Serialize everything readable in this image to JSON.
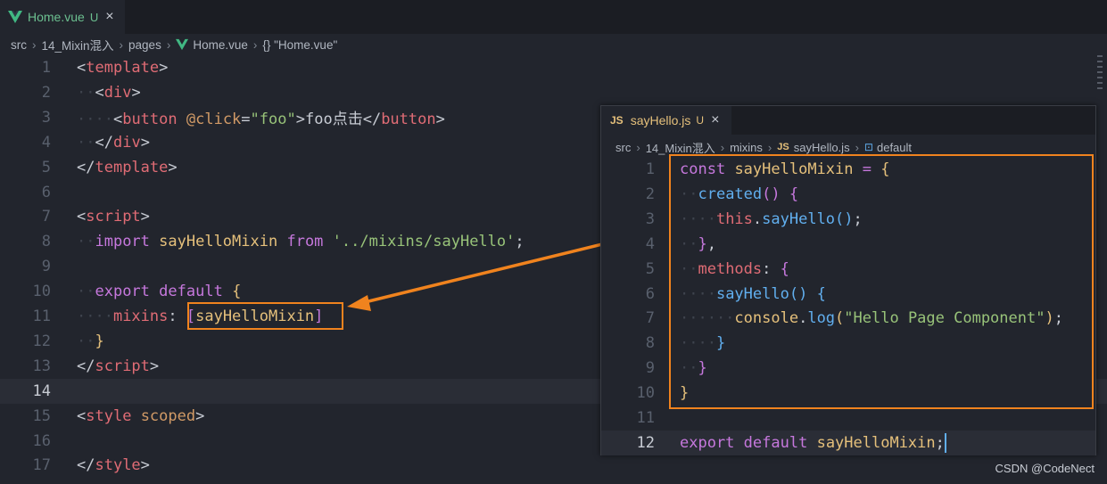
{
  "main_tab": {
    "name": "Home.vue",
    "status": "U",
    "close": "×"
  },
  "breadcrumb": [
    "src",
    "14_Mixin混入",
    "pages",
    "Home.vue",
    "{} \"Home.vue\""
  ],
  "main_lines": [
    {
      "n": "1",
      "code": [
        [
          "t-brk",
          "<"
        ],
        [
          "t-tag",
          "template"
        ],
        [
          "t-brk",
          ">"
        ]
      ]
    },
    {
      "n": "2",
      "code": [
        [
          "indent",
          "··"
        ],
        [
          "t-brk",
          "<"
        ],
        [
          "t-tag",
          "div"
        ],
        [
          "t-brk",
          ">"
        ]
      ]
    },
    {
      "n": "3",
      "code": [
        [
          "indent",
          "····"
        ],
        [
          "t-brk",
          "<"
        ],
        [
          "t-tag",
          "button"
        ],
        [
          "t-plain",
          " "
        ],
        [
          "t-attr",
          "@click"
        ],
        [
          "t-plain",
          "="
        ],
        [
          "t-str",
          "\"foo\""
        ],
        [
          "t-brk",
          ">"
        ],
        [
          "t-plain",
          "foo点击"
        ],
        [
          "t-brk",
          "</"
        ],
        [
          "t-tag",
          "button"
        ],
        [
          "t-brk",
          ">"
        ]
      ]
    },
    {
      "n": "4",
      "code": [
        [
          "indent",
          "··"
        ],
        [
          "t-brk",
          "</"
        ],
        [
          "t-tag",
          "div"
        ],
        [
          "t-brk",
          ">"
        ]
      ]
    },
    {
      "n": "5",
      "code": [
        [
          "t-brk",
          "</"
        ],
        [
          "t-tag",
          "template"
        ],
        [
          "t-brk",
          ">"
        ]
      ]
    },
    {
      "n": "6",
      "code": []
    },
    {
      "n": "7",
      "code": [
        [
          "t-brk",
          "<"
        ],
        [
          "t-tag",
          "script"
        ],
        [
          "t-brk",
          ">"
        ]
      ]
    },
    {
      "n": "8",
      "code": [
        [
          "indent",
          "··"
        ],
        [
          "t-kw",
          "import"
        ],
        [
          "t-plain",
          " "
        ],
        [
          "t-var",
          "sayHelloMixin"
        ],
        [
          "t-plain",
          " "
        ],
        [
          "t-kw",
          "from"
        ],
        [
          "t-plain",
          " "
        ],
        [
          "t-str",
          "'../mixins/sayHello'"
        ],
        [
          "t-plain",
          ";"
        ]
      ]
    },
    {
      "n": "9",
      "code": []
    },
    {
      "n": "10",
      "code": [
        [
          "indent",
          "··"
        ],
        [
          "t-kw",
          "export"
        ],
        [
          "t-plain",
          " "
        ],
        [
          "t-kw",
          "default"
        ],
        [
          "t-plain",
          " "
        ],
        [
          "t-br1",
          "{"
        ]
      ]
    },
    {
      "n": "11",
      "code": [
        [
          "indent",
          "····"
        ],
        [
          "t-prop",
          "mixins"
        ],
        [
          "t-plain",
          ": "
        ],
        [
          "t-br2",
          "["
        ],
        [
          "t-var",
          "sayHelloMixin"
        ],
        [
          "t-br2",
          "]"
        ]
      ]
    },
    {
      "n": "12",
      "code": [
        [
          "indent",
          "··"
        ],
        [
          "t-br1",
          "}"
        ]
      ]
    },
    {
      "n": "13",
      "code": [
        [
          "t-brk",
          "</"
        ],
        [
          "t-tag",
          "script"
        ],
        [
          "t-brk",
          ">"
        ]
      ]
    },
    {
      "n": "14",
      "code": [],
      "active": true
    },
    {
      "n": "15",
      "code": [
        [
          "t-brk",
          "<"
        ],
        [
          "t-tag",
          "style"
        ],
        [
          "t-plain",
          " "
        ],
        [
          "t-attr",
          "scoped"
        ],
        [
          "t-brk",
          ">"
        ]
      ]
    },
    {
      "n": "16",
      "code": []
    },
    {
      "n": "17",
      "code": [
        [
          "t-brk",
          "</"
        ],
        [
          "t-tag",
          "style"
        ],
        [
          "t-brk",
          ">"
        ]
      ]
    }
  ],
  "overlay_tab": {
    "icon": "JS",
    "name": "sayHello.js",
    "status": "U",
    "close": "×"
  },
  "overlay_breadcrumb": [
    "src",
    "14_Mixin混入",
    "mixins",
    "sayHello.js",
    "default"
  ],
  "overlay_lines": [
    {
      "n": "1",
      "code": [
        [
          "t-kw",
          "const"
        ],
        [
          "t-plain",
          " "
        ],
        [
          "t-var",
          "sayHelloMixin"
        ],
        [
          "t-plain",
          " "
        ],
        [
          "t-kw",
          "="
        ],
        [
          "t-plain",
          " "
        ],
        [
          "t-br1",
          "{"
        ]
      ]
    },
    {
      "n": "2",
      "code": [
        [
          "indent",
          "··"
        ],
        [
          "t-fn",
          "created"
        ],
        [
          "t-br2",
          "()"
        ],
        [
          "t-plain",
          " "
        ],
        [
          "t-br2",
          "{"
        ]
      ]
    },
    {
      "n": "3",
      "code": [
        [
          "indent",
          "····"
        ],
        [
          "t-tag",
          "this"
        ],
        [
          "t-plain",
          "."
        ],
        [
          "t-fn",
          "sayHello"
        ],
        [
          "t-br3",
          "()"
        ],
        [
          "t-plain",
          ";"
        ]
      ]
    },
    {
      "n": "4",
      "code": [
        [
          "indent",
          "··"
        ],
        [
          "t-br2",
          "}"
        ],
        [
          "t-plain",
          ","
        ]
      ]
    },
    {
      "n": "5",
      "code": [
        [
          "indent",
          "··"
        ],
        [
          "t-prop",
          "methods"
        ],
        [
          "t-plain",
          ": "
        ],
        [
          "t-br2",
          "{"
        ]
      ]
    },
    {
      "n": "6",
      "code": [
        [
          "indent",
          "····"
        ],
        [
          "t-fn",
          "sayHello"
        ],
        [
          "t-br3",
          "()"
        ],
        [
          "t-plain",
          " "
        ],
        [
          "t-br3",
          "{"
        ]
      ]
    },
    {
      "n": "7",
      "code": [
        [
          "indent",
          "······"
        ],
        [
          "t-var",
          "console"
        ],
        [
          "t-plain",
          "."
        ],
        [
          "t-fn",
          "log"
        ],
        [
          "t-br1",
          "("
        ],
        [
          "t-str",
          "\"Hello Page Component\""
        ],
        [
          "t-br1",
          ")"
        ],
        [
          "t-plain",
          ";"
        ]
      ]
    },
    {
      "n": "8",
      "code": [
        [
          "indent",
          "····"
        ],
        [
          "t-br3",
          "}"
        ]
      ]
    },
    {
      "n": "9",
      "code": [
        [
          "indent",
          "··"
        ],
        [
          "t-br2",
          "}"
        ]
      ]
    },
    {
      "n": "10",
      "code": [
        [
          "t-br1",
          "}"
        ]
      ]
    },
    {
      "n": "11",
      "code": []
    },
    {
      "n": "12",
      "code": [
        [
          "t-kw",
          "export"
        ],
        [
          "t-plain",
          " "
        ],
        [
          "t-kw",
          "default"
        ],
        [
          "t-plain",
          " "
        ],
        [
          "t-var",
          "sayHelloMixin"
        ],
        [
          "t-plain",
          ";"
        ]
      ],
      "active": true
    }
  ],
  "watermark": "CSDN @CodeNect",
  "colors": {
    "accent": "#f0831e",
    "vue_green": "#41b883",
    "js_yellow": "#e5c07b"
  }
}
